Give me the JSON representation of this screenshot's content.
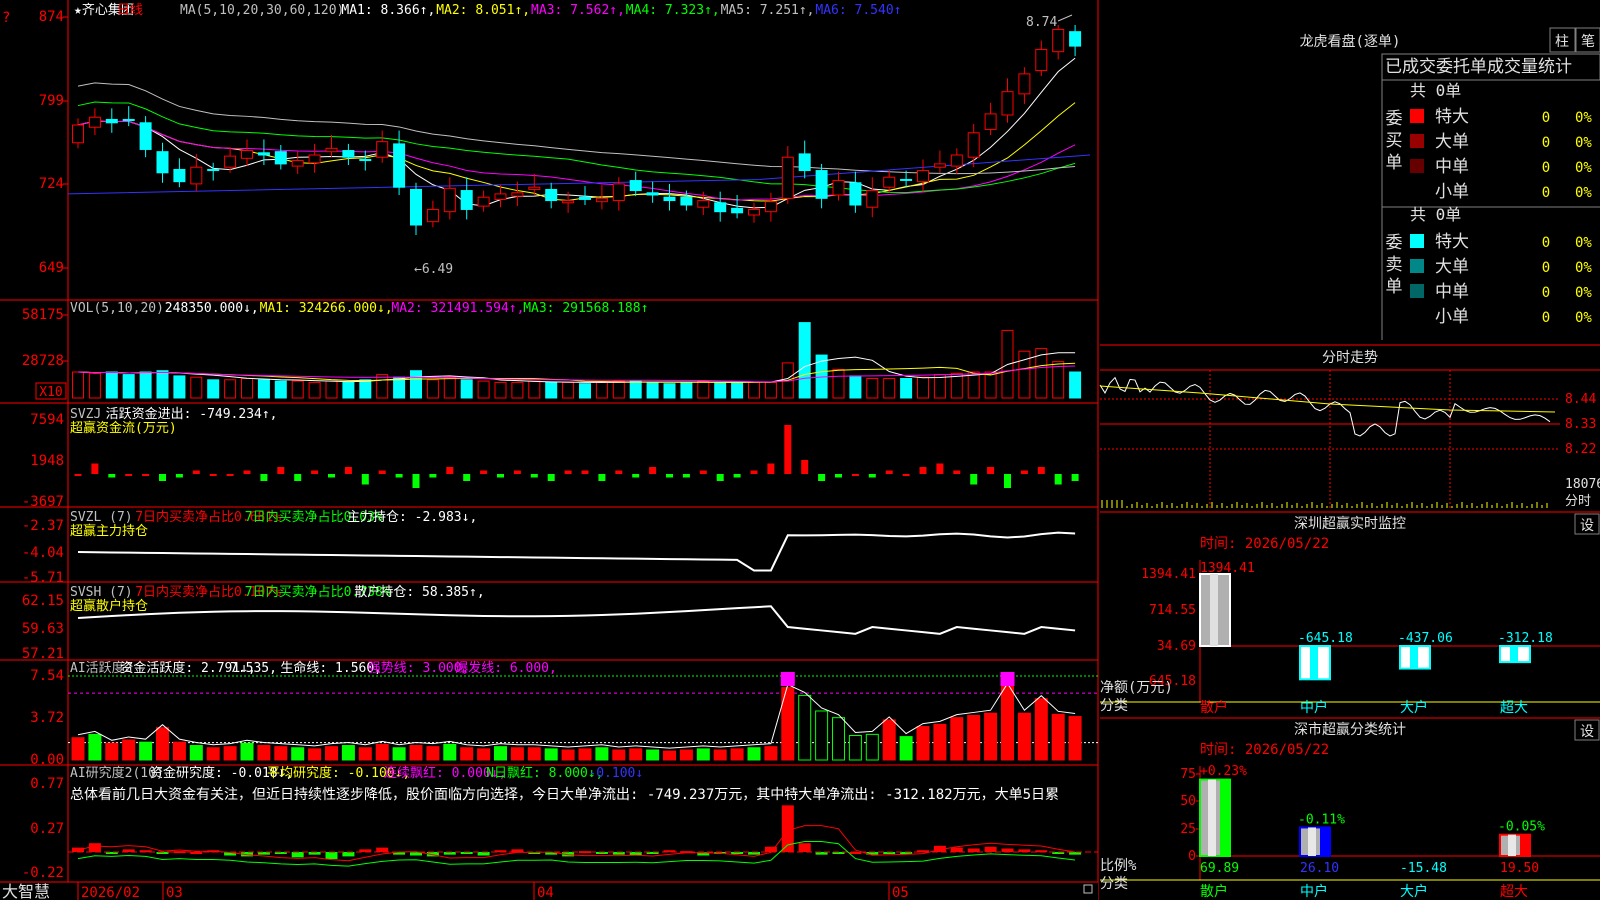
{
  "title": "★齐心集团",
  "period": "日线",
  "ma_header": [
    {
      "text": "MA(5,10,20,30,60,120)",
      "color": "#c0c0c0"
    },
    {
      "text": "MA1: 8.366↑,",
      "color": "#ffffff"
    },
    {
      "text": "MA2: 8.051↑,",
      "color": "#ffff00"
    },
    {
      "text": "MA3: 7.562↑,",
      "color": "#ff00ff"
    },
    {
      "text": "MA4: 7.323↑,",
      "color": "#00ff00"
    },
    {
      "text": "MA5: 7.251↑,",
      "color": "#c0c0c0"
    },
    {
      "text": "MA6: 7.540↑",
      "color": "#3333ff"
    }
  ],
  "price_axis": [
    "874",
    "799",
    "724",
    "649"
  ],
  "price_annot_high": "8.74",
  "price_annot_low": "←6.49",
  "vol_header": [
    {
      "text": "VOL(5,10,20)",
      "color": "#c0c0c0"
    },
    {
      "text": "248350.000↓,",
      "color": "#ffffff"
    },
    {
      "text": "MA1: 324266.000↓,",
      "color": "#ffff00"
    },
    {
      "text": "MA2: 321491.594↑,",
      "color": "#ff00ff"
    },
    {
      "text": "MA3: 291568.188↑",
      "color": "#00ff00"
    }
  ],
  "vol_axis": [
    "58175",
    "28728"
  ],
  "vol_unit": "X10",
  "svzj_header": [
    {
      "text": "SVZJ",
      "color": "#c0c0c0"
    },
    {
      "text": "活跃资金进出: -749.234↑,",
      "color": "#ffffff"
    }
  ],
  "svzj_sub": "超赢资金流(万元)",
  "svzj_axis": [
    "7594",
    "1948",
    "-3697"
  ],
  "svzl_header": [
    {
      "text": "SVZL (7)",
      "color": "#c0c0c0"
    },
    {
      "text": "7日内买卖净占比0.681%",
      "color": "#ff0000"
    },
    {
      "text": "7日内买卖净占比0.03%",
      "color": "#00ff00"
    },
    {
      "text": "主力持仓: -2.983↓,",
      "color": "#ffffff"
    }
  ],
  "svzl_sub": "超赢主力持仓",
  "svzl_axis": [
    "-2.37",
    "-4.04",
    "-5.71"
  ],
  "svsh_header": [
    {
      "text": "SVSH (7)",
      "color": "#c0c0c0"
    },
    {
      "text": "7日内买卖净占比0.107%",
      "color": "#ff0000"
    },
    {
      "text": "7日内买卖净占比0.738%",
      "color": "#00ff00"
    },
    {
      "text": "散户持仓: 58.385↑,",
      "color": "#ffffff"
    }
  ],
  "svsh_sub": "超赢散户持仓",
  "svsh_axis": [
    "62.15",
    "59.63",
    "57.21"
  ],
  "ai1_header": [
    {
      "text": "AI活跃度2",
      "color": "#c0c0c0"
    },
    {
      "text": "资金活跃度: 2.791↓,",
      "color": "#ffffff"
    },
    {
      "text": "7.535,",
      "color": "#ffffff"
    },
    {
      "text": "生命线: 1.560,",
      "color": "#ffffff"
    },
    {
      "text": "强势线: 3.000,",
      "color": "#ff00ff"
    },
    {
      "text": "爆发线: 6.000,",
      "color": "#ff00ff"
    }
  ],
  "ai1_axis": [
    "7.54",
    "3.72",
    "0.00"
  ],
  "ai2_header": [
    {
      "text": "AI研究度2(10)",
      "color": "#c0c0c0"
    },
    {
      "text": "资金研究度: -0.018↓,",
      "color": "#ffffff"
    },
    {
      "text": "平均研究度: -0.100↓,",
      "color": "#ffff00"
    },
    {
      "text": "连续飘红: 0.000↓,",
      "color": "#ff00ff"
    },
    {
      "text": "N日飘红: 8.000↓,",
      "color": "#00ff00"
    },
    {
      "text": "-0.100↓",
      "color": "#3333ff"
    }
  ],
  "ai2_text": "总体看前几日大资金有关注，但近日持续性逐步降低，股价面临方向选择，今日大单净流出: -749.237万元，其中特大单净流出: -312.182万元，大单5日累",
  "ai2_axis": [
    "0.77",
    "0.27",
    "-0.22"
  ],
  "footer_brand": "大智慧",
  "date_labels": [
    "2026/02",
    "03",
    "04",
    "05"
  ],
  "lhb": {
    "title": "龙虎看盘(逐单)",
    "btn_zhu": "柱",
    "btn_bi": "笔",
    "tabs": [
      "已成交",
      "委托单",
      "成交量统计"
    ],
    "buy_label": "委买单",
    "sell_label": "委卖单",
    "buy_total": "共 0单",
    "sell_total": "共 0单",
    "buy_rows": [
      {
        "name": "特大",
        "count": "0",
        "pct": "0%",
        "color": "#ff0000"
      },
      {
        "name": "大单",
        "count": "0",
        "pct": "0%",
        "color": "#990000"
      },
      {
        "name": "中单",
        "count": "0",
        "pct": "0%",
        "color": "#660000"
      },
      {
        "name": "小单",
        "count": "0",
        "pct": "0%",
        "color": ""
      }
    ],
    "sell_rows": [
      {
        "name": "特大",
        "count": "0",
        "pct": "0%",
        "color": "#00ffff"
      },
      {
        "name": "大单",
        "count": "0",
        "pct": "0%",
        "color": "#008888"
      },
      {
        "name": "中单",
        "count": "0",
        "pct": "0%",
        "color": "#006666"
      },
      {
        "name": "小单",
        "count": "0",
        "pct": "0%",
        "color": ""
      }
    ]
  },
  "intraday": {
    "title": "分时走势",
    "axis": [
      "8.44",
      "8.33",
      "8.22"
    ],
    "vol_label": "18076",
    "vol_sub": "分时"
  },
  "monitor": {
    "title": "深圳超赢实时监控",
    "btn": "设",
    "time": "时间: 2026/05/22",
    "axis": [
      "1394.41",
      "714.55",
      "34.69",
      "-645.18"
    ],
    "unit_label": "净额(万元)",
    "cat_label": "分类",
    "bars": [
      {
        "label": "散户",
        "value": "1394.41",
        "v": 1394.41
      },
      {
        "label": "中户",
        "value": "-645.18",
        "v": -645.18
      },
      {
        "label": "大户",
        "value": "-437.06",
        "v": -437.06
      },
      {
        "label": "超大",
        "value": "-312.18",
        "v": -312.18
      }
    ]
  },
  "classify": {
    "title": "深市超赢分类统计",
    "btn": "设",
    "time": "时间: 2026/05/22",
    "axis": [
      "75",
      "50",
      "25",
      "0"
    ],
    "unit_label": "比例%",
    "cat_label": "分类",
    "bars": [
      {
        "label": "散户",
        "top": "+0.23%",
        "value": "69.89",
        "v": 69.89,
        "vc": "#00ff00",
        "lc": "#00ff00",
        "fill": "#00ff00"
      },
      {
        "label": "中户",
        "top": "-0.11%",
        "value": "26.10",
        "v": 26.1,
        "vc": "#3333ff",
        "lc": "#00ffff",
        "fill": "#0000ff"
      },
      {
        "label": "大户",
        "top": "",
        "value": "-15.48",
        "v": 0,
        "vc": "#00ffff",
        "lc": "#00ffff",
        "fill": "#00ffff"
      },
      {
        "label": "超大",
        "top": "-0.05%",
        "value": "19.50",
        "v": 19.5,
        "vc": "#ff0000",
        "lc": "#ff0000",
        "fill": "#ff0000"
      }
    ]
  },
  "colors": {
    "up": "#ff0000",
    "down": "#00ffff",
    "border": "#ff0000",
    "grid": "#800000"
  }
}
